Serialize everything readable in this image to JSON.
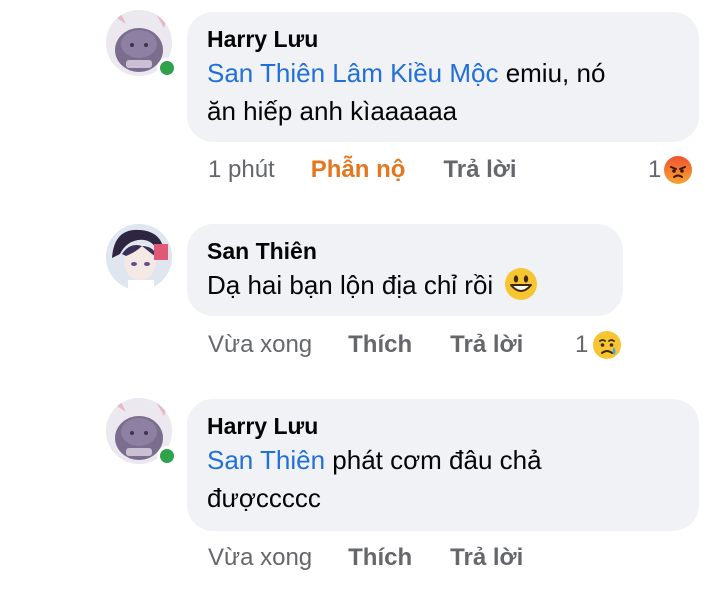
{
  "comments": [
    {
      "author": "Harry Lưu",
      "mention": "San Thiên Lâm Kiều Mộc",
      "text_line1": " emiu, nó",
      "text_line2": "ăn hiếp anh kìaaaaaa",
      "time": "1 phút",
      "reaction_action": "Phẫn nộ",
      "reply_label": "Trả lời",
      "reaction_count": "1",
      "reaction_icon": "angry-emoji-icon",
      "online": true
    },
    {
      "author": "San Thiên",
      "text_line1": "Dạ hai bạn lộn địa chỉ rồi",
      "time": "Vừa xong",
      "like_label": "Thích",
      "reply_label": "Trả lời",
      "reaction_count": "1",
      "reaction_icon": "sad-emoji-icon",
      "inline_emoji": "grinning-emoji-icon",
      "online": false
    },
    {
      "author": "Harry Lưu",
      "mention": "San Thiên",
      "text_line1": " phát cơm đâu chả",
      "text_line2": "đượccccc",
      "time": "Vừa xong",
      "like_label": "Thích",
      "reply_label": "Trả lời",
      "online": true
    }
  ],
  "colors": {
    "mention": "#216fdb",
    "angry_action": "#e4761e",
    "meta_gray": "#65676b",
    "bubble_bg": "#f0f2f5",
    "online": "#31a24c"
  }
}
